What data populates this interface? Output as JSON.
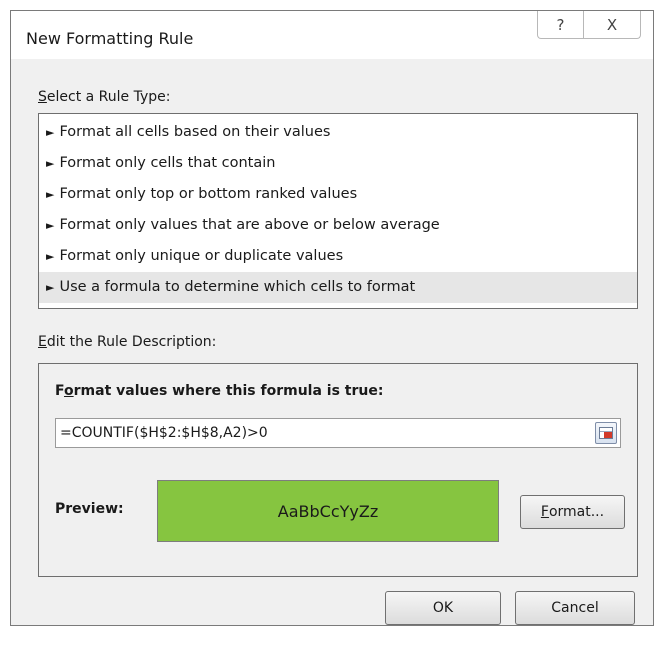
{
  "window": {
    "title": "New Formatting Rule",
    "help_glyph": "?",
    "close_glyph": "X"
  },
  "rule_type": {
    "label_mnemonic": "S",
    "label_rest": "elect a Rule Type:",
    "items": [
      {
        "label": "Format all cells based on their values",
        "selected": false
      },
      {
        "label": "Format only cells that contain",
        "selected": false
      },
      {
        "label": "Format only top or bottom ranked values",
        "selected": false
      },
      {
        "label": "Format only values that are above or below average",
        "selected": false
      },
      {
        "label": "Format only unique or duplicate values",
        "selected": false
      },
      {
        "label": "Use a formula to determine which cells to format",
        "selected": true
      }
    ],
    "bullet": "►"
  },
  "rule_description": {
    "label_mnemonic": "E",
    "label_rest": "dit the Rule Description:",
    "formula_label_mnemonic": "o",
    "formula_label_pre": "F",
    "formula_label_rest": "rmat values where this formula is true:",
    "formula_value": "=COUNTIF($H$2:$H$8,A2)>0",
    "preview_label": "Preview:",
    "preview_text": "AaBbCcYyZz",
    "preview_fill": "#86c540",
    "format_button_mnemonic": "F",
    "format_button_rest": "ormat..."
  },
  "buttons": {
    "ok": "OK",
    "cancel": "Cancel"
  }
}
